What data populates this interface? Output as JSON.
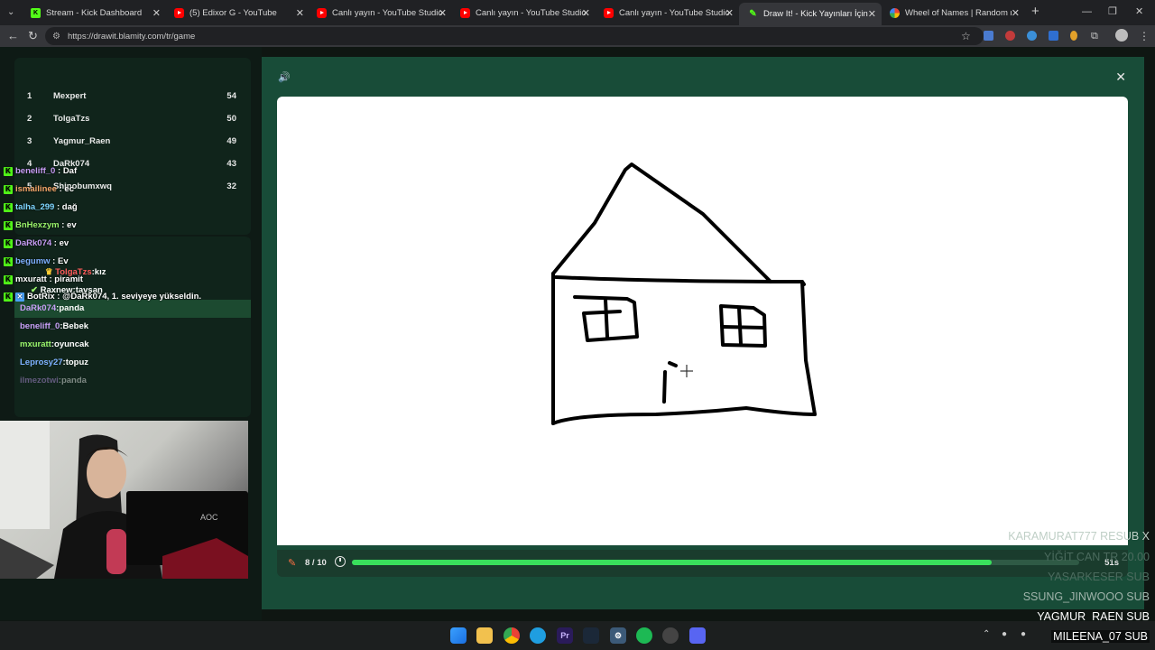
{
  "browser": {
    "tabs": [
      {
        "title": "Stream - Kick Dashboard",
        "icon": "kick-icon",
        "active": false
      },
      {
        "title": "(5) Edixor G - YouTube",
        "icon": "youtube-icon",
        "active": false
      },
      {
        "title": "Canlı yayın - YouTube Studio",
        "icon": "youtube-icon",
        "active": false
      },
      {
        "title": "Canlı yayın - YouTube Studio",
        "icon": "youtube-icon",
        "active": false
      },
      {
        "title": "Canlı yayın - YouTube Studio",
        "icon": "youtube-icon",
        "active": false
      },
      {
        "title": "Draw It! - Kick Yayınları İçin Çizim",
        "icon": "pencil-icon",
        "active": true
      },
      {
        "title": "Wheel of Names | Random name",
        "icon": "wheel-icon",
        "active": false
      }
    ],
    "url": "https://drawit.blamity.com/tr/game"
  },
  "leaderboard": [
    {
      "rank": "1",
      "name": "Mexpert",
      "points": "54"
    },
    {
      "rank": "2",
      "name": "TolgaTzs",
      "points": "50"
    },
    {
      "rank": "3",
      "name": "Yagmur_Raen",
      "points": "49"
    },
    {
      "rank": "4",
      "name": "DaRk074",
      "points": "43"
    },
    {
      "rank": "5",
      "name": "Shinobumxwq",
      "points": "32"
    }
  ],
  "stream_chat": [
    {
      "user": "beneliff_0",
      "message": "Daf",
      "color": "#c79df5"
    },
    {
      "user": "ismailinee",
      "message": "ec",
      "color": "#f5a86b"
    },
    {
      "user": "talha_299",
      "message": "dağ",
      "color": "#7ed6ff"
    },
    {
      "user": "BnHexzym",
      "message": "ev",
      "color": "#9bf56b"
    },
    {
      "user": "DaRk074",
      "message": "ev",
      "color": "#c79df5"
    },
    {
      "user": "begumw",
      "message": "Ev",
      "color": "#7eb0ff"
    },
    {
      "user": "mxuratt",
      "message": "piramit",
      "color": "#ffffff"
    },
    {
      "user": "BotRix",
      "message": "@DaRk074, 1. seviyeye yükseldin.",
      "color": "#ffffff"
    }
  ],
  "game_chat": [
    {
      "user": "TolgaTzs",
      "message": "kız",
      "color": "#ff5a5a"
    },
    {
      "user": "Raxnew",
      "message": "tavşan",
      "color": "#ffffff"
    },
    {
      "user": "DaRk074",
      "message": "panda",
      "color": "#c79df5"
    },
    {
      "user": "beneliff_0",
      "message": "Bebek",
      "color": "#c79df5"
    },
    {
      "user": "mxuratt",
      "message": "oyuncak",
      "color": "#9bf56b"
    },
    {
      "user": "Leprosy27",
      "message": "topuz",
      "color": "#7eb0ff"
    },
    {
      "user": "ilmezotwi",
      "message": "panda",
      "color": "#c79df5"
    }
  ],
  "game": {
    "round": "8 / 10",
    "time_left": "51s",
    "progress": 0.88
  },
  "sub_ticker": [
    {
      "text": "KARAMURAT777  RESUB X",
      "color": "#bfcfc6"
    },
    {
      "text": "YİĞİT CAN  TR  20.00",
      "color": "#4b6b5e"
    },
    {
      "text": "YASARKESER  SUB",
      "color": "#4b6b5e"
    },
    {
      "text": "SSUNG_JINWOOO  SUB",
      "color": "#9fb3aa"
    },
    {
      "text": "YAGMUR_RAEN  SUB",
      "color": "#ffffff"
    },
    {
      "text": "MILEENA_07  SUB",
      "color": "#ffffff"
    }
  ],
  "colors": {
    "kick_green": "#53fc18",
    "game_bg": "#184c38",
    "progress_fill": "#39e05c"
  }
}
